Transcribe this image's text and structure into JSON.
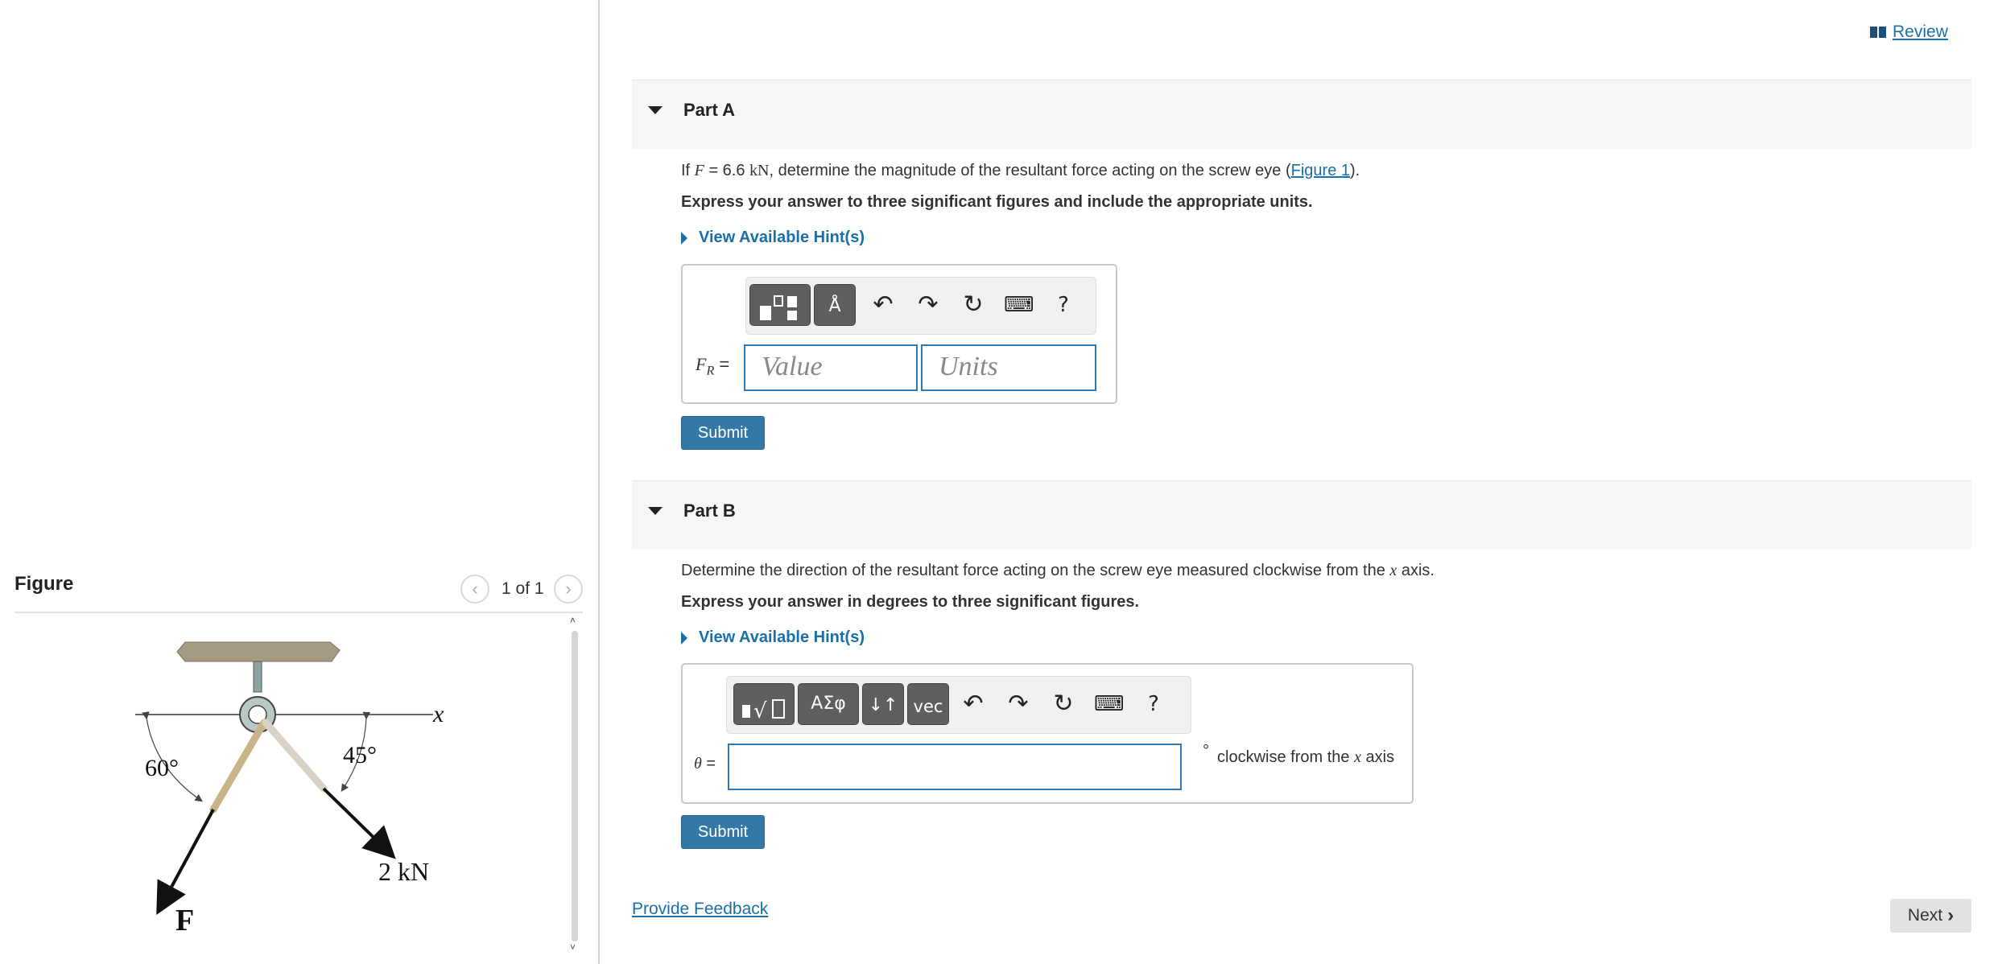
{
  "header": {
    "review_label": "Review"
  },
  "figure": {
    "title": "Figure",
    "page_indicator": "1 of 1",
    "labels": {
      "x_axis": "x",
      "left_angle": "60°",
      "right_angle": "45°",
      "force_value": "2 kN",
      "force_name": "F"
    }
  },
  "partA": {
    "title": "Part A",
    "question": {
      "prefix": "If ",
      "var": "F",
      "equals": " = 6.6 ",
      "unit": "kN",
      "text": ", determine the magnitude of the resultant force acting on the screw eye (",
      "link": "Figure 1",
      "suffix": ")."
    },
    "instruction": "Express your answer to three significant figures and include the appropriate units.",
    "hint_label": "View Available Hint(s)",
    "input_label_var": "F",
    "input_label_sub": "R",
    "input_label_eq": " =",
    "value_placeholder": "Value",
    "units_placeholder": "Units",
    "submit_label": "Submit"
  },
  "partB": {
    "title": "Part B",
    "question": {
      "text": "Determine the direction of the resultant force acting on the screw eye measured clockwise from the ",
      "var": "x",
      "suffix": " axis."
    },
    "instruction": "Express your answer in degrees to three significant figures.",
    "hint_label": "View Available Hint(s)",
    "input_label_var": "θ",
    "input_label_eq": " =",
    "toolbar_labels": {
      "symbols": "ΑΣφ",
      "vec": "vec"
    },
    "degree_symbol": "°",
    "unit_text": "clockwise from the ",
    "unit_var": "x",
    "unit_suffix": " axis",
    "submit_label": "Submit"
  },
  "footer": {
    "feedback_label": "Provide Feedback",
    "next_label": "Next"
  },
  "icons": {
    "toolbar": [
      "templates-icon",
      "units-icon",
      "undo-icon",
      "redo-icon",
      "reset-icon",
      "keyboard-icon",
      "help-icon"
    ],
    "toolbar_b": [
      "templates-icon",
      "symbols-icon",
      "arrows-icon",
      "vector-icon",
      "undo-icon",
      "redo-icon",
      "reset-icon",
      "keyboard-icon",
      "help-icon"
    ]
  },
  "colors": {
    "link": "#1a6fa8",
    "submit": "#3478a6",
    "input_border": "#2e79b5",
    "header_bg": "#f6f6f6"
  }
}
